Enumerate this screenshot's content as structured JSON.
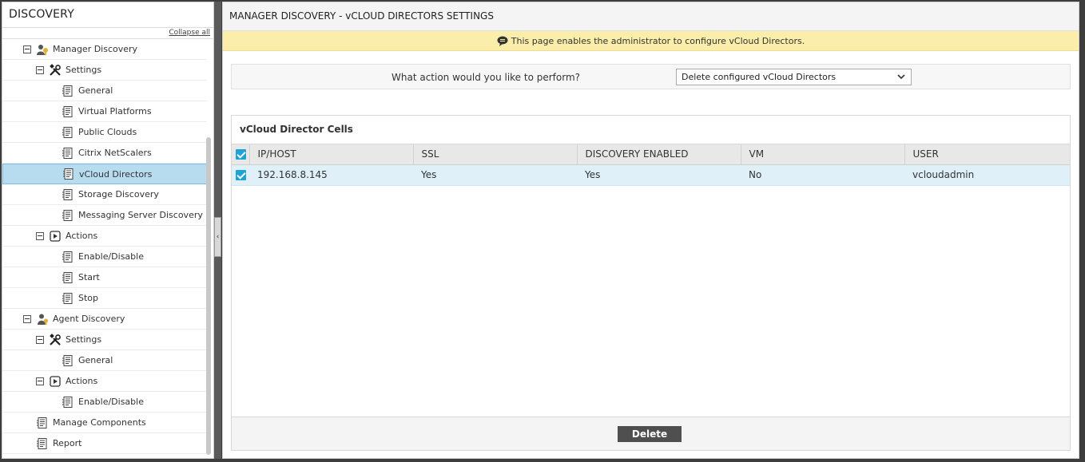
{
  "sidebar": {
    "title": "DISCOVERY",
    "collapse_all": "Collapse all",
    "items": [
      {
        "label": "Manager Discovery",
        "level": 0,
        "toggle": true,
        "icon": "manager-icon"
      },
      {
        "label": "Settings",
        "level": 1,
        "toggle": true,
        "icon": "tools-icon"
      },
      {
        "label": "General",
        "level": 2,
        "toggle": false,
        "icon": "page-icon"
      },
      {
        "label": "Virtual Platforms",
        "level": 2,
        "toggle": false,
        "icon": "page-icon"
      },
      {
        "label": "Public Clouds",
        "level": 2,
        "toggle": false,
        "icon": "page-icon"
      },
      {
        "label": "Citrix NetScalers",
        "level": 2,
        "toggle": false,
        "icon": "page-icon"
      },
      {
        "label": "vCloud Directors",
        "level": 2,
        "toggle": false,
        "icon": "page-icon",
        "selected": true
      },
      {
        "label": "Storage Discovery",
        "level": 2,
        "toggle": false,
        "icon": "page-icon"
      },
      {
        "label": "Messaging Server Discovery",
        "level": 2,
        "toggle": false,
        "icon": "page-icon"
      },
      {
        "label": "Actions",
        "level": 1,
        "toggle": true,
        "icon": "actions-icon"
      },
      {
        "label": "Enable/Disable",
        "level": 2,
        "toggle": false,
        "icon": "page-icon"
      },
      {
        "label": "Start",
        "level": 2,
        "toggle": false,
        "icon": "page-icon"
      },
      {
        "label": "Stop",
        "level": 2,
        "toggle": false,
        "icon": "page-icon"
      },
      {
        "label": "Agent Discovery",
        "level": 0,
        "toggle": true,
        "icon": "agent-icon"
      },
      {
        "label": "Settings",
        "level": 1,
        "toggle": true,
        "icon": "tools-icon"
      },
      {
        "label": "General",
        "level": 2,
        "toggle": false,
        "icon": "page-icon"
      },
      {
        "label": "Actions",
        "level": 1,
        "toggle": true,
        "icon": "actions-icon"
      },
      {
        "label": "Enable/Disable",
        "level": 2,
        "toggle": false,
        "icon": "page-icon"
      },
      {
        "label": "Manage Components",
        "level": 0,
        "toggle": false,
        "icon": "page-icon"
      },
      {
        "label": "Report",
        "level": 0,
        "toggle": false,
        "icon": "page-icon"
      }
    ]
  },
  "main": {
    "title": "MANAGER DISCOVERY - vCLOUD DIRECTORS SETTINGS",
    "info": "This page enables the administrator to configure vCloud Directors.",
    "action_question": "What action would you like to perform?",
    "action_selected": "Delete configured vCloud Directors",
    "cells_title": "vCloud Director Cells",
    "columns": [
      "IP/HOST",
      "SSL",
      "DISCOVERY ENABLED",
      "VM",
      "USER"
    ],
    "rows": [
      {
        "ip": "192.168.8.145",
        "ssl": "Yes",
        "discovery": "Yes",
        "vm": "No",
        "user": "vcloudadmin",
        "checked": true
      }
    ],
    "delete_label": "Delete"
  },
  "colors": {
    "accent": "#1ea4d4",
    "selected_bg": "#b7dcf0",
    "info_bg": "#fbeeaa",
    "button_bg": "#4f4f4f"
  }
}
